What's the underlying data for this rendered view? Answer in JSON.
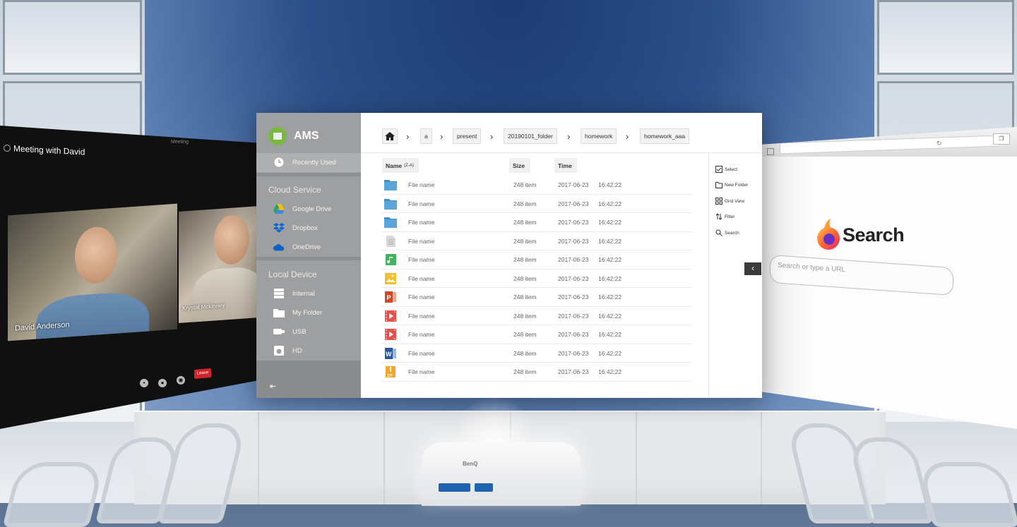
{
  "meeting": {
    "title": "Meeting with David",
    "subtitle": "Meeting",
    "participant_main": "David Anderson",
    "participant_side": "Krystal Mckinney",
    "leave_label": "Leave"
  },
  "browser": {
    "brand": "Search",
    "search_placeholder": "Search or type a URL"
  },
  "ams": {
    "app_name": "AMS",
    "accent_color": "#7bb841",
    "recently_used": "Recently Used",
    "cloud_heading": "Cloud Service",
    "cloud_items": [
      "Google Drive",
      "Dropbox",
      "OneDrive"
    ],
    "local_heading": "Local Device",
    "local_items": [
      "Internal",
      "My Folder",
      "USB",
      "HD"
    ],
    "breadcrumb": [
      "a",
      "present",
      "20190101_folder",
      "homework",
      "homework_aaa"
    ],
    "columns": {
      "name": "Name",
      "name_sort": "(Z-A)",
      "size": "Size",
      "time": "Time"
    },
    "files": [
      {
        "icon": "folder-icon",
        "name": "File name",
        "size": "248 item",
        "date": "2017-06-23",
        "time": "16:42:22"
      },
      {
        "icon": "folder-icon",
        "name": "File name",
        "size": "248 item",
        "date": "2017-06-23",
        "time": "16:42:22"
      },
      {
        "icon": "folder-icon",
        "name": "File name",
        "size": "248 item",
        "date": "2017-06-23",
        "time": "16:42:22"
      },
      {
        "icon": "document-icon",
        "name": "File name",
        "size": "248 item",
        "date": "2017-06-23",
        "time": "16:42:22"
      },
      {
        "icon": "music-icon",
        "name": "File name",
        "size": "248 item",
        "date": "2017-06-23",
        "time": "16:42:22"
      },
      {
        "icon": "image-icon",
        "name": "File name",
        "size": "248 item",
        "date": "2017-06-23",
        "time": "16:42:22"
      },
      {
        "icon": "powerpoint-icon",
        "name": "File name",
        "size": "248 item",
        "date": "2017-06-23",
        "time": "16:42:22"
      },
      {
        "icon": "video-icon",
        "name": "File name",
        "size": "248 item",
        "date": "2017-06-23",
        "time": "16:42:22"
      },
      {
        "icon": "video-icon",
        "name": "File name",
        "size": "248 item",
        "date": "2017-06-23",
        "time": "16:42:22"
      },
      {
        "icon": "word-icon",
        "name": "File name",
        "size": "248 item",
        "date": "2017-06-23",
        "time": "16:42:22"
      },
      {
        "icon": "zip-icon",
        "name": "File name",
        "size": "248 item",
        "date": "2017-06-23",
        "time": "16:42:22"
      }
    ],
    "actions": [
      "Select",
      "New Folder",
      "Grid View",
      "Filter",
      "Search"
    ]
  }
}
